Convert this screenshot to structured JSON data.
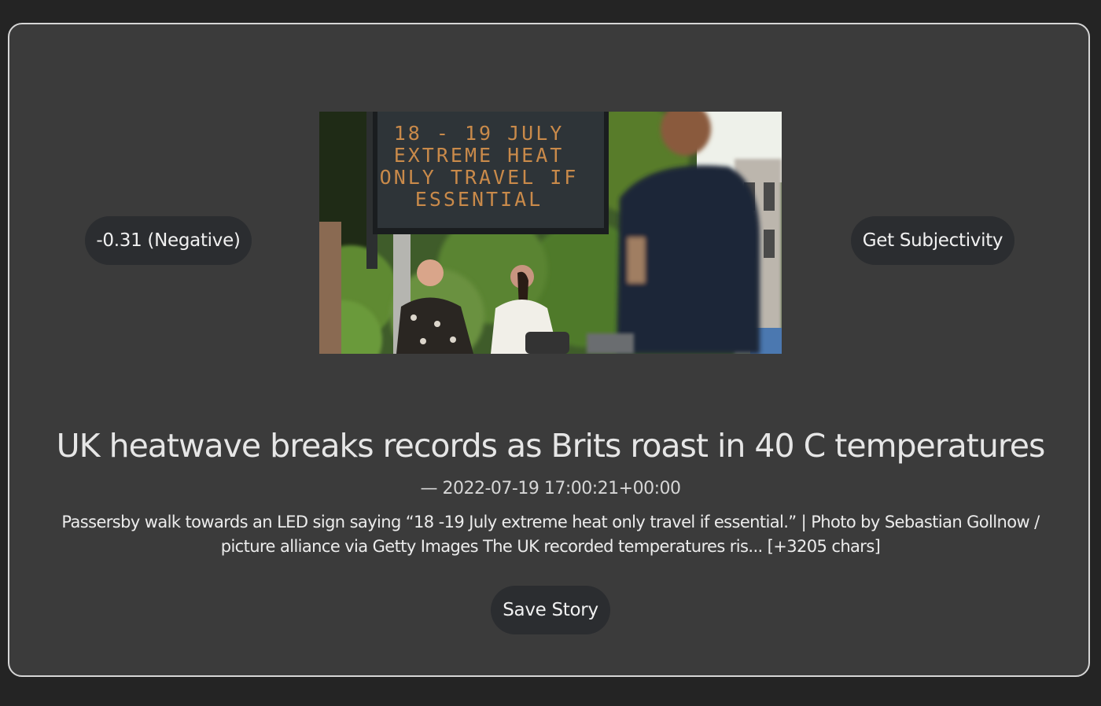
{
  "story": {
    "sentiment_label": "-0.31 (Negative)",
    "subjectivity_button": "Get Subjectivity",
    "photo": {
      "sign_lines": [
        "18 - 19 JULY",
        "EXTREME HEAT",
        "ONLY TRAVEL IF",
        "ESSENTIAL"
      ]
    },
    "headline": "UK heatwave breaks records as Brits roast in 40 C temperatures",
    "timestamp": "— 2022-07-19 17:00:21+00:00",
    "description": "Passersby walk towards an LED sign saying “18 -19 July extreme heat only travel if essential.”  | Photo by Sebastian Gollnow / picture alliance via Getty Images The UK recorded temperatures ris... [+3205 chars]",
    "save_button": "Save Story"
  },
  "colors": {
    "page_background": "#242424",
    "card_background": "#3b3b3b",
    "card_border": "#d6d6d6",
    "pill_background": "#2b2d30",
    "text": "#e6e6e6",
    "led_text": "#c98a4a"
  }
}
